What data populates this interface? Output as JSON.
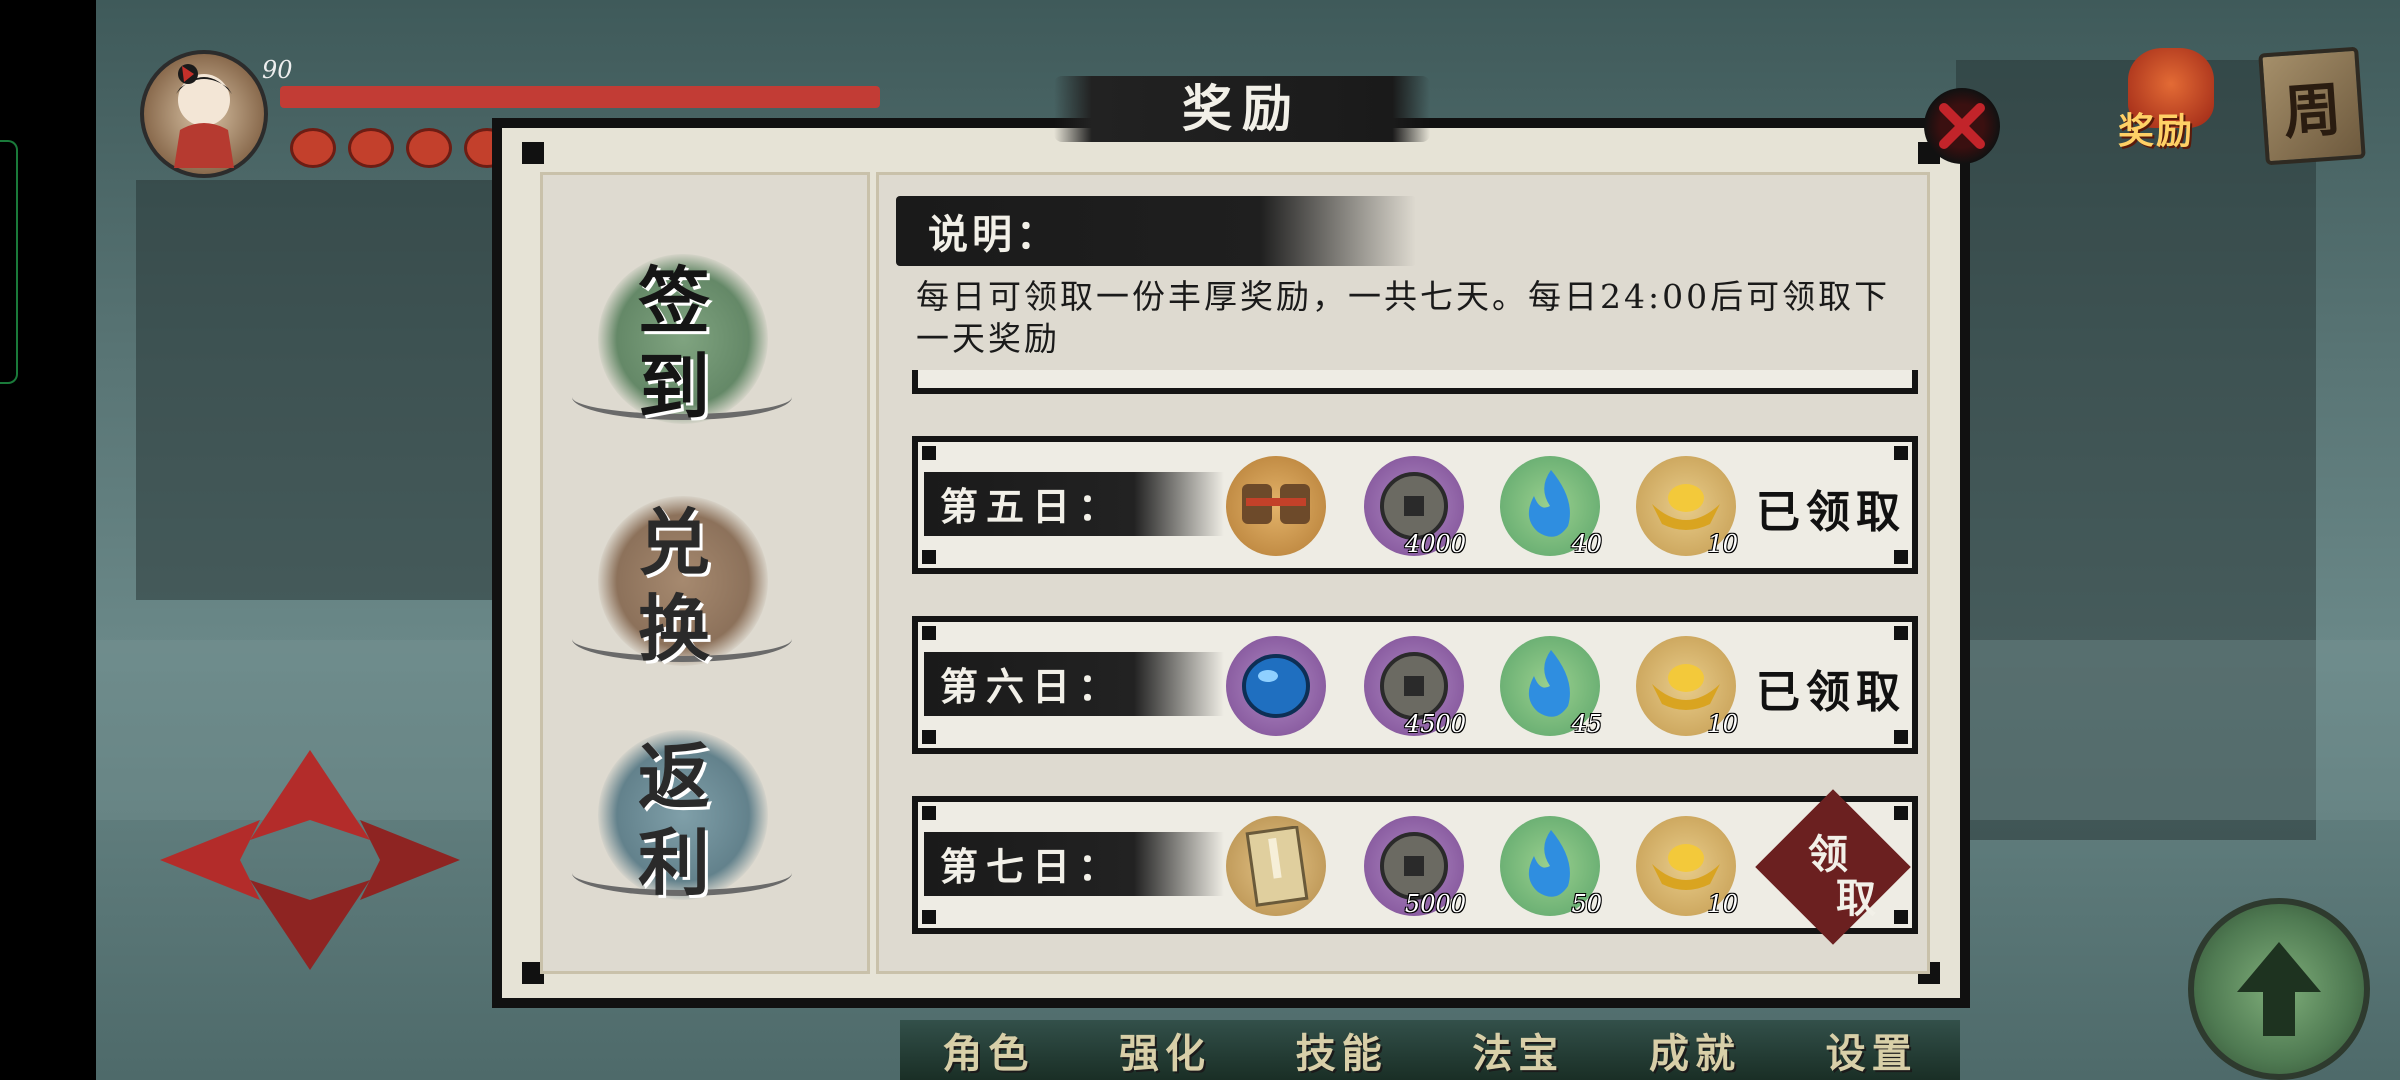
{
  "modal": {
    "title": "奖励",
    "tabs": [
      {
        "line1": "签",
        "line2": "到",
        "active": true
      },
      {
        "line1": "兑",
        "line2": "换",
        "active": false
      },
      {
        "line1": "返",
        "line2": "利",
        "active": false
      }
    ],
    "info_label": "说明：",
    "info_text": "每日可领取一份丰厚奖励，一共七天。每日24:00后可领取下一天奖励",
    "rows": [
      {
        "day": "第五日：",
        "items": [
          {
            "icon": "gloves-icon",
            "qty": ""
          },
          {
            "icon": "coin-icon",
            "qty": "4000"
          },
          {
            "icon": "blue-flame-icon",
            "qty": "40"
          },
          {
            "icon": "gold-ingot-icon",
            "qty": "10"
          }
        ],
        "status": "已领取"
      },
      {
        "day": "第六日：",
        "items": [
          {
            "icon": "blue-gem-icon",
            "qty": ""
          },
          {
            "icon": "coin-icon",
            "qty": "4500"
          },
          {
            "icon": "blue-flame-icon",
            "qty": "45"
          },
          {
            "icon": "gold-ingot-icon",
            "qty": "10"
          }
        ],
        "status": "已领取"
      },
      {
        "day": "第七日：",
        "items": [
          {
            "icon": "book-icon",
            "qty": ""
          },
          {
            "icon": "coin-icon",
            "qty": "5000"
          },
          {
            "icon": "blue-flame-icon",
            "qty": "50"
          },
          {
            "icon": "gold-ingot-icon",
            "qty": "10"
          }
        ],
        "claim_line1": "领",
        "claim_line2": "取"
      }
    ]
  },
  "hud": {
    "level": "90",
    "reward_button": "奖励",
    "week_button": "周"
  },
  "bottom_nav": [
    "角色",
    "强化",
    "技能",
    "法宝",
    "成就",
    "设置"
  ],
  "colors": {
    "hp": "#c23c35",
    "claim_splash": "#6b2020",
    "panel": "#e6e3d6"
  }
}
